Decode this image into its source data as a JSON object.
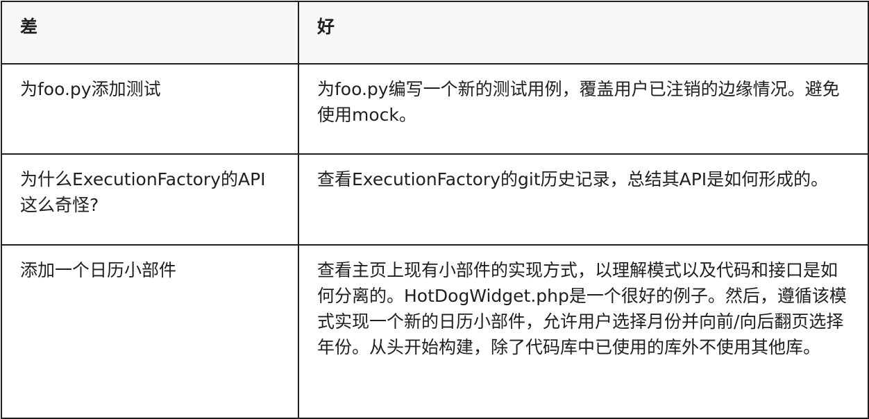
{
  "table": {
    "headers": {
      "bad": "差",
      "good": "好"
    },
    "rows": [
      {
        "bad": "为foo.py添加测试",
        "good": "为foo.py编写一个新的测试用例，覆盖用户已注销的边缘情况。避免使用mock。"
      },
      {
        "bad": "为什么ExecutionFactory的API这么奇怪?",
        "good": "查看ExecutionFactory的git历史记录，总结其API是如何形成的。"
      },
      {
        "bad": "添加一个日历小部件",
        "good": "查看主页上现有小部件的实现方式，以理解模式以及代码和接口是如何分离的。HotDogWidget.php是一个很好的例子。然后，遵循该模式实现一个新的日历小部件，允许用户选择月份并向前/向后翻页选择年份。从头开始构建，除了代码库中已使用的库外不使用其他库。"
      }
    ]
  }
}
